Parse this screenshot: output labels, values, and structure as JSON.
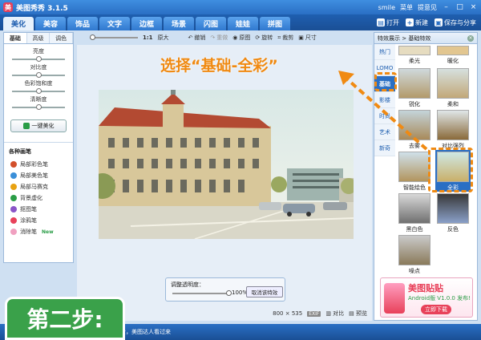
{
  "window": {
    "title": "美图秀秀 3.1.5",
    "user": "smile",
    "menu": "菜单",
    "feedback": "提意见"
  },
  "main_tabs": [
    "美化",
    "美容",
    "饰品",
    "文字",
    "边框",
    "场景",
    "闪图",
    "娃娃",
    "拼图"
  ],
  "toolbar_actions": [
    {
      "label": "打开",
      "icon": "folder-icon"
    },
    {
      "label": "新建",
      "icon": "plus-icon"
    },
    {
      "label": "保存与分享",
      "icon": "save-icon"
    }
  ],
  "left_panel": {
    "sub_tabs": [
      "基础",
      "高级",
      "调色"
    ],
    "adjust_labels": [
      "亮度",
      "对比度",
      "色彩饱和度",
      "清晰度"
    ],
    "beautify_button": "一键美化",
    "brushes_title": "各种画笔",
    "brushes": [
      "局部彩色笔",
      "局部美色笔",
      "局部马赛克",
      "背景虚化",
      "抠图笔",
      "涂鸦笔",
      "消除笔"
    ],
    "new_badge": "New"
  },
  "center_toolbar": {
    "zoom_label": "1:1",
    "original_size": "原大",
    "undo": "撤销",
    "redo": "重做",
    "original_image": "原图",
    "rotate": "旋转",
    "crop": "裁剪",
    "size": "尺寸"
  },
  "annotation": "选择“基础-全彩”",
  "opacity_panel": {
    "label": "调整透明度：",
    "value": "100%",
    "cancel_button": "取消该特效"
  },
  "bottom_bar": {
    "dimensions": "800 × 535",
    "exif": "EXIF",
    "compare": "对比",
    "preview": "预览"
  },
  "right_panel": {
    "breadcrumb": "特效展示 > 基础特效",
    "categories": [
      "热门",
      "LOMO",
      "基础",
      "影楼",
      "时尚",
      "艺术",
      "新奇"
    ],
    "effects": [
      "柔光",
      "暖化",
      "锐化",
      "柔和",
      "去雾",
      "对比强烈",
      "智能绘色",
      "全彩",
      "黑白色",
      "反色",
      "噪点"
    ],
    "selected_effect": "全彩"
  },
  "ad": {
    "title": "美图贴贴",
    "subtitle": "Android版 V1.0.0 发布!",
    "button": "立即下载"
  },
  "status_bar": {
    "text": "士，美图达人看过来"
  },
  "step_badge": "第二步:",
  "colors": {
    "accent": "#2a6fc4",
    "highlight": "#f08a12",
    "badge": "#3aa14a"
  }
}
